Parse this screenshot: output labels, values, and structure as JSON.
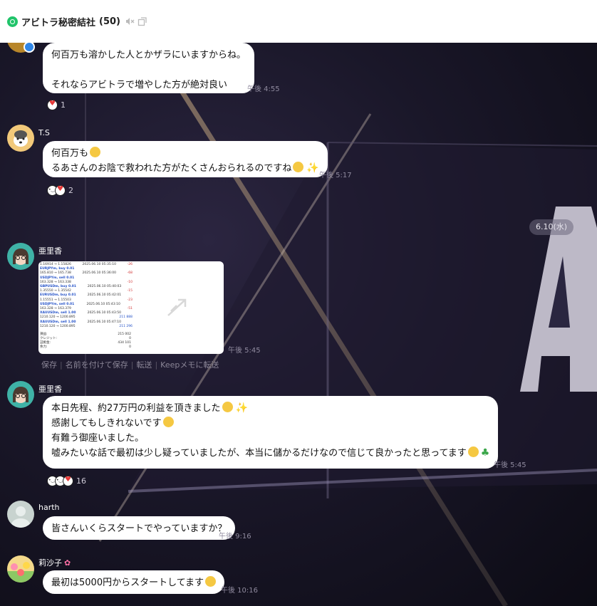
{
  "header": {
    "title": "アビトラ秘密結社",
    "member_count": "(50)"
  },
  "date_separator": "6.10(水)",
  "messages": [
    {
      "lines": [
        "何百万も溶かした人とかザラにいますからね。",
        "",
        "それならアビトラで増やした方が絶対良い"
      ],
      "time": "午後 4:55",
      "reaction_count": "1"
    },
    {
      "sender": "T.S",
      "lines": [
        "何百万も",
        "るあさんのお陰で救われた方がたくさんおられるのですね"
      ],
      "time": "午後 5:17",
      "reaction_count": "2"
    },
    {
      "sender": "亜里香",
      "image_time": "午後 5:45",
      "image_actions": [
        "保存",
        "名前を付けて保存",
        "転送",
        "Keepメモに転送"
      ]
    },
    {
      "sender": "亜里香",
      "lines": [
        "本日先程、約27万円の利益を頂きました",
        "感謝してもしきれないです",
        "有難う御座いました。",
        "嘘みたいな話で最初は少し疑っていましたが、本当に儲かるだけなので信じて良かったと思ってます"
      ],
      "time": "午後 5:45",
      "reaction_count": "16"
    },
    {
      "sender": "harth",
      "lines": [
        "皆さんいくらスタートでやっていますか？"
      ],
      "time": "午後 9:16"
    },
    {
      "sender": "莉沙子",
      "lines": [
        "最初は5000円からスタートしてます"
      ],
      "time": "午後 10:16"
    }
  ],
  "screenshot_text": {
    "rows": [
      [
        "1.16914 → 1.15826",
        "2025.06.10 05:35:10",
        "-26"
      ],
      [
        "EURJPYm, buy 0.01",
        "",
        ""
      ],
      [
        "165.810 → 165.738",
        "2025.06.10 05:36:00",
        "-68"
      ],
      [
        "USDJPYm, sell 0.01",
        "",
        ""
      ],
      [
        "163.328 → 163.338",
        "",
        "-10"
      ],
      [
        "GBPUSDm, buy 0.01",
        "2025.06.10 05:40:03",
        ""
      ],
      [
        "1.35550 → 1.35542",
        "",
        "-15"
      ],
      [
        "EURUSDm, buy 0.01",
        "2025.06.10 05:42:01",
        ""
      ],
      [
        "1.15551 → 1.15503",
        "",
        "-23"
      ],
      [
        "USDJPYm, sell 0.01",
        "2025.06.10 05:43:10",
        ""
      ],
      [
        "163.328 → 163.379",
        "",
        "-51"
      ],
      [
        "XAUUSDm, sell 1.00",
        "2025.06.10 05:43:50",
        ""
      ],
      [
        "1210.120 → 1200.895",
        "",
        "211 888"
      ],
      [
        "XAUUSDm, sell 1.00",
        "2025.06.10 05:47:10",
        ""
      ],
      [
        "1210.120 → 1200.895",
        "",
        "211 296"
      ]
    ],
    "summary": [
      [
        "損益:",
        "215 002"
      ],
      [
        "クレジット:",
        "0"
      ],
      [
        "証拠金:",
        "434 101"
      ],
      [
        "余力:",
        "0"
      ]
    ]
  },
  "colors": {
    "accent_green": "#20c46a",
    "bubble_bg": "#ffffff",
    "chat_bg": "#1a1729",
    "reaction_heart": "#e53a3a"
  }
}
